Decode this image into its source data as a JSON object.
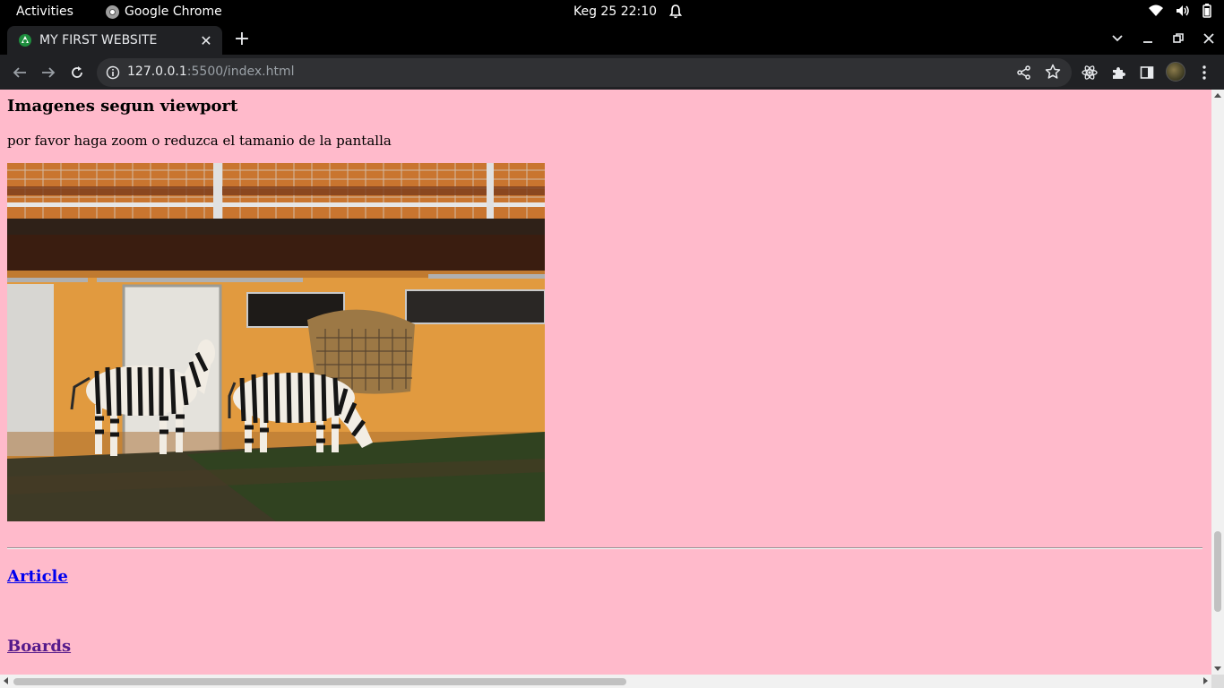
{
  "system_bar": {
    "activities": "Activities",
    "app_name": "Google Chrome",
    "clock": "Keg 25  22:10",
    "icons": [
      "wifi-icon",
      "volume-icon",
      "battery-icon"
    ]
  },
  "browser": {
    "tab_title": "MY FIRST WEBSITE",
    "url_host": "127.0.0.1",
    "url_rest": ":5500/index.html"
  },
  "page": {
    "heading": "Imagenes segun viewport",
    "paragraph": "por favor haga zoom o reduzca el tamanio de la pantalla",
    "image_subject": "zebras-by-orange-barn-wall",
    "links": [
      {
        "label": "Article",
        "state": "unvisited"
      },
      {
        "label": "Boards",
        "state": "visited"
      }
    ]
  },
  "colors": {
    "page_background": "#ffbacb",
    "link_unvisited": "#0000ee",
    "link_visited": "#551a8b",
    "chrome_dark": "#202124"
  },
  "scroll": {
    "vertical_position_fraction": 0.9,
    "horizontal_visible_fraction": 0.5
  }
}
